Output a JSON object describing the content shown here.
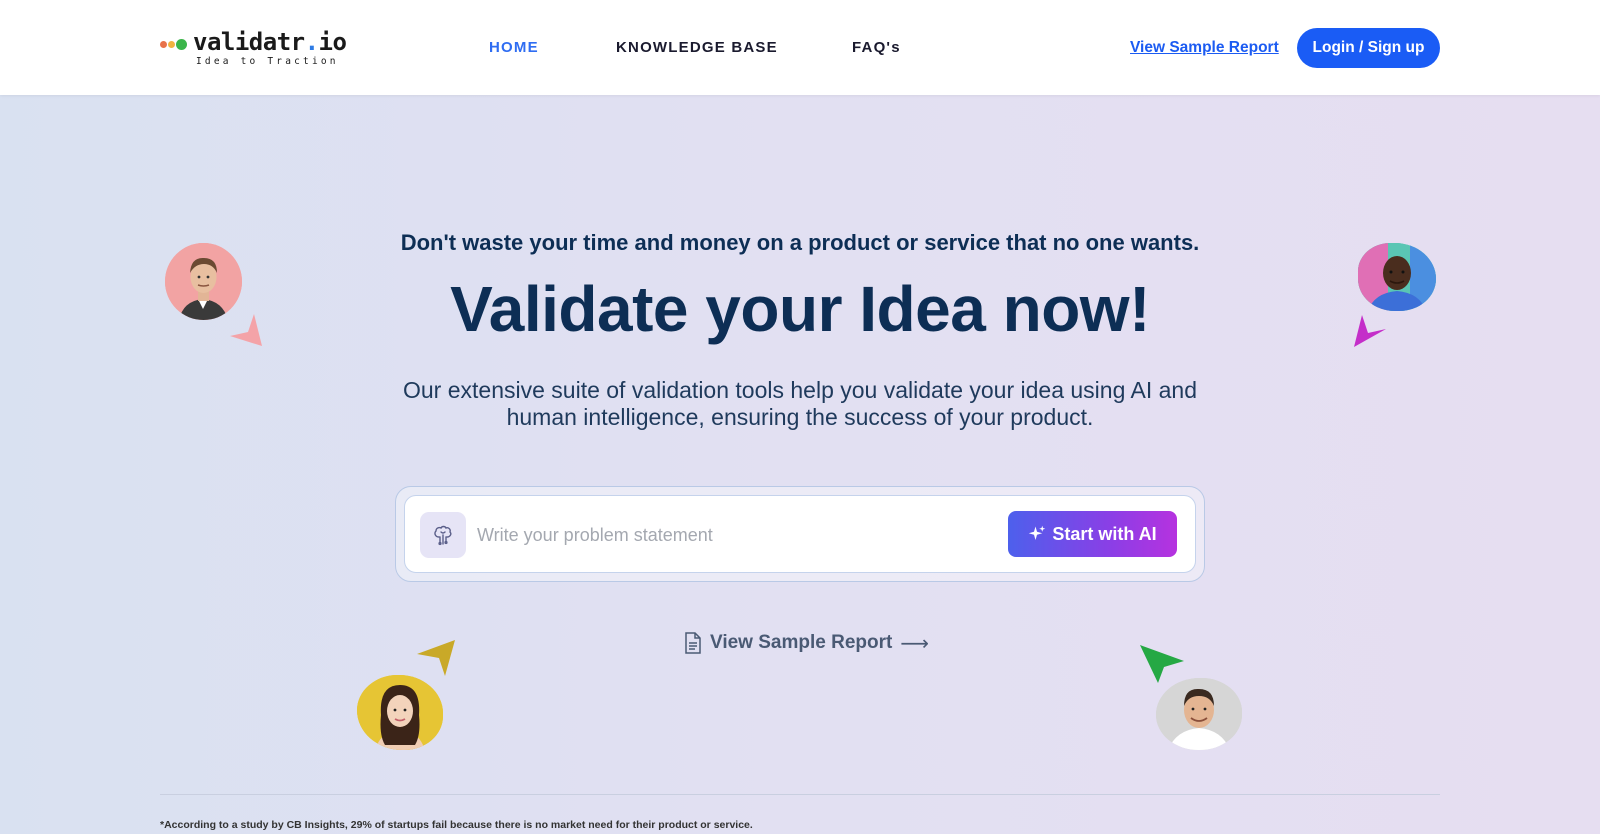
{
  "header": {
    "logo_text": "validatr",
    "logo_dot": ".",
    "logo_tld": "io",
    "logo_tagline": "Idea to Traction",
    "nav": [
      {
        "label": "HOME",
        "active": true
      },
      {
        "label": "KNOWLEDGE BASE",
        "active": false
      },
      {
        "label": "FAQ's",
        "active": false
      }
    ],
    "sample_report_label": "View Sample Report",
    "login_label": "Login / Sign up"
  },
  "hero": {
    "kicker": "Don't waste your time and money on a product or service that no one wants.",
    "headline": "Validate your Idea now!",
    "subtext": "Our extensive suite of validation tools help you validate your idea using AI and human intelligence, ensuring the success of your product."
  },
  "search": {
    "placeholder": "Write your problem statement",
    "value": "",
    "button_label": "Start with AI"
  },
  "sample_link": {
    "label": "View Sample Report",
    "arrow": "⟶"
  },
  "icons": {
    "brain": "brain-icon",
    "sparkle": "sparkle-icon",
    "document": "document-icon",
    "arrow_right": "arrow-right-icon"
  },
  "colors": {
    "primary": "#1a5cf5",
    "nav_active": "#2f6df2",
    "heading": "#0d2e55",
    "cta_gradient_start": "#4d60ec",
    "cta_gradient_end": "#b632df"
  },
  "footer": {
    "footnote": "*According to a study by CB Insights, 29% of startups fail because there is no market need for their product or service."
  }
}
